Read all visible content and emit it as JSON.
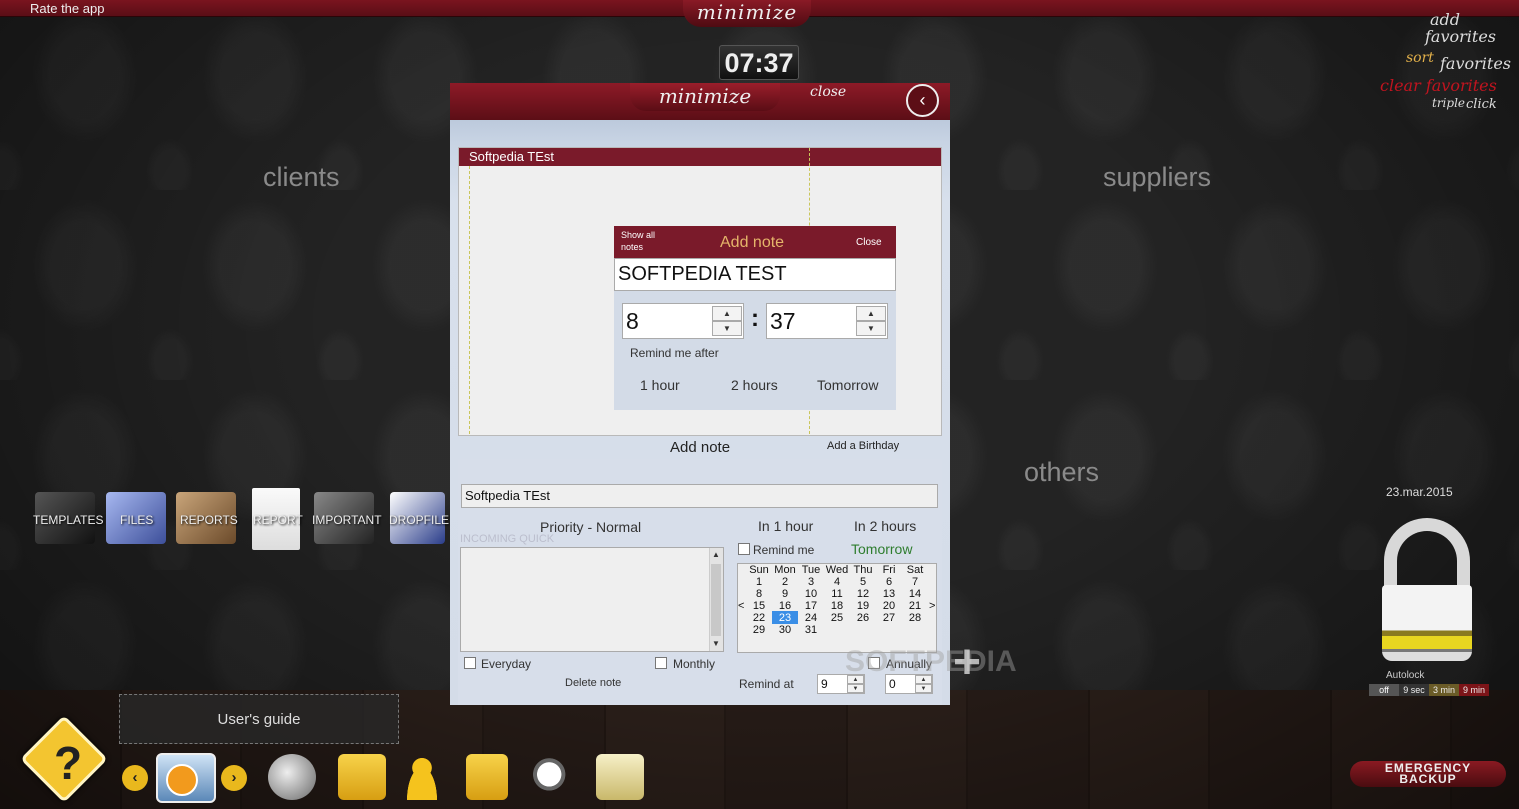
{
  "topbar": {
    "rate_app": "Rate the app",
    "minimize": "minimize"
  },
  "clock": "07:37",
  "favorites": {
    "add_1": "add",
    "add_2": "favorites",
    "sort_1": "sort",
    "sort_2": "favorites",
    "clear": "clear favorites",
    "triple": "triple",
    "click": "click"
  },
  "sections": {
    "clients": "clients",
    "suppliers": "suppliers",
    "others": "others"
  },
  "folders": [
    "TEMPLATES",
    "FILES",
    "REPORTS",
    "REPORT",
    "IMPORTANT",
    "DROPFILE"
  ],
  "guide": "User's guide",
  "help": "?",
  "dock": {
    "prev": "‹",
    "next": "›"
  },
  "lock": {
    "date": "23.mar.2015",
    "autolock": "Autolock",
    "options": [
      "off",
      "9 sec",
      "3 min",
      "9 min"
    ]
  },
  "emergency": {
    "line1": "EMERGENCY",
    "line2": "BACKUP"
  },
  "modal": {
    "minimize": "minimize",
    "close": "close",
    "back": "‹",
    "card_title": "Softpedia TEst",
    "add_note_link": "Add note",
    "add_birthday": "Add a Birthday"
  },
  "add_note": {
    "show_all": "Show all notes",
    "title": "Add note",
    "close": "Close",
    "text": "SOFTPEDIA TEST",
    "hours": "8",
    "minutes": "37",
    "colon": ":",
    "remind_after": "Remind me after",
    "quick": [
      "1 hour",
      "2 hours",
      "Tomorrow"
    ]
  },
  "editor": {
    "title": "Softpedia TEst",
    "priority": "Priority - Normal",
    "incoming": "INCOMING    QUICK",
    "in_1_hour": "In 1 hour",
    "in_2_hours": "In 2 hours",
    "remind_me": "Remind me",
    "tomorrow": "Tomorrow",
    "everyday": "Everyday",
    "monthly": "Monthly",
    "annually": "Annually",
    "delete_note": "Delete note",
    "remind_at": "Remind at",
    "remind_hour": "9",
    "remind_min": "0"
  },
  "calendar": {
    "days": [
      "Sun",
      "Mon",
      "Tue",
      "Wed",
      "Thu",
      "Fri",
      "Sat"
    ],
    "weeks": [
      [
        "1",
        "2",
        "3",
        "4",
        "5",
        "6",
        "7"
      ],
      [
        "8",
        "9",
        "10",
        "11",
        "12",
        "13",
        "14"
      ],
      [
        "15",
        "16",
        "17",
        "18",
        "19",
        "20",
        "21"
      ],
      [
        "22",
        "23",
        "24",
        "25",
        "26",
        "27",
        "28"
      ],
      [
        "29",
        "30",
        "31",
        "",
        "",
        "",
        ""
      ]
    ],
    "selected": "23",
    "prev": "<",
    "next": ">"
  },
  "watermark": "SOFTPEDIA",
  "colors": {
    "accent": "#7a1a2a",
    "brand_red": "#8d1a27",
    "gold": "#e3b14a",
    "green": "#2e7d2e",
    "selected": "#3a8ee6"
  }
}
